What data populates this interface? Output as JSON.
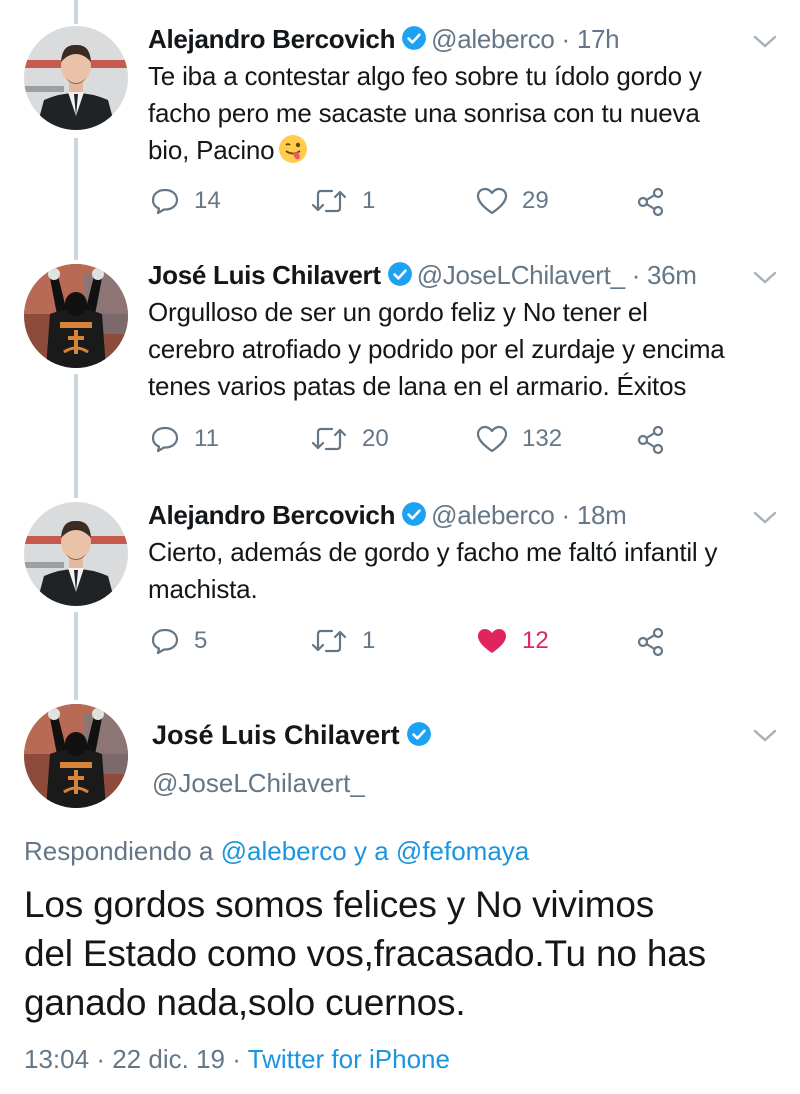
{
  "colors": {
    "link": "#1b95e0",
    "muted": "#657786",
    "like": "#e0245e",
    "verified": "#1da1f2"
  },
  "tweets": [
    {
      "name": "Alejandro Bercovich",
      "handle": "@aleberco",
      "sep": "·",
      "time": "17h",
      "lines": [
        "Te iba a contestar algo feo sobre tu ídolo gordo y",
        "facho pero me sacaste una sonrisa con tu nueva",
        "bio, Pacino"
      ],
      "emoji": "winking-face-with-tongue",
      "replies": "14",
      "retweets": "1",
      "likes": "29",
      "liked": false
    },
    {
      "name": "José Luis Chilavert",
      "handle": "@JoseLChilavert_",
      "sep": "·",
      "time": "36m",
      "lines": [
        "Orgulloso de ser un gordo feliz y No tener el",
        "cerebro atrofiado y podrido por el zurdaje y encima",
        "tenes varios patas de lana en el armario. Éxitos"
      ],
      "replies": "11",
      "retweets": "20",
      "likes": "132",
      "liked": false
    },
    {
      "name": "Alejandro Bercovich",
      "handle": "@aleberco",
      "sep": "·",
      "time": "18m",
      "lines": [
        "Cierto, además de gordo y facho me faltó infantil y",
        "machista."
      ],
      "replies": "5",
      "retweets": "1",
      "likes": "12",
      "liked": true
    }
  ],
  "main_tweet": {
    "name": "José Luis Chilavert",
    "handle": "@JoseLChilavert_",
    "replying_prefix": "Respondiendo a",
    "replying_user1": "@aleberco",
    "replying_and": "y a",
    "replying_user2": "@fefomaya",
    "lines": [
      "Los gordos somos felices y No vivimos",
      "del Estado como vos,fracasado.Tu no has",
      "ganado nada,solo cuernos."
    ],
    "time": "13:04",
    "sep1": "·",
    "date": "22 dic. 19",
    "sep2": "·",
    "client": "Twitter for iPhone"
  }
}
